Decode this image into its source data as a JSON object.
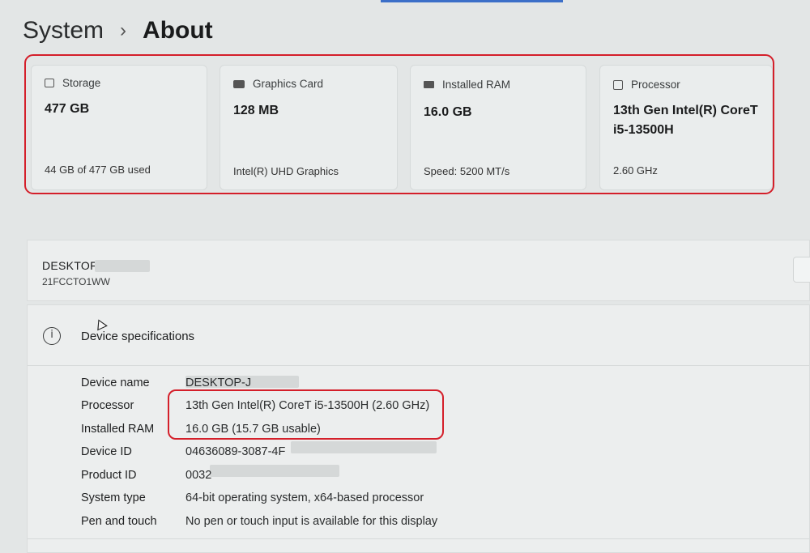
{
  "header": {
    "parent": "System",
    "separator": "›",
    "current": "About"
  },
  "cards": [
    {
      "icon": "storage-icon",
      "label": "Storage",
      "value": "477 GB",
      "sub": "44 GB of 477 GB used"
    },
    {
      "icon": "graphics-card-icon",
      "label": "Graphics Card",
      "value": "128 MB",
      "sub": "Intel(R) UHD Graphics"
    },
    {
      "icon": "ram-icon",
      "label": "Installed RAM",
      "value": "16.0 GB",
      "sub": "Speed: 5200 MT/s"
    },
    {
      "icon": "processor-icon",
      "label": "Processor",
      "value": "13th Gen Intel(R) CoreT i5-13500H",
      "sub": "2.60 GHz"
    }
  ],
  "device": {
    "name": "DESKTOF",
    "model": "21FCCTO1WW"
  },
  "specs": {
    "title": "Device specifications",
    "rows": [
      {
        "label": "Device name",
        "value": "DESKTOP-J"
      },
      {
        "label": "Processor",
        "value": "13th Gen Intel(R) CoreT i5-13500H (2.60 GHz)"
      },
      {
        "label": "Installed RAM",
        "value": "16.0 GB (15.7 GB usable)"
      },
      {
        "label": "Device ID",
        "value": "04636089-3087-4F"
      },
      {
        "label": "Product ID",
        "value": "0032"
      },
      {
        "label": "System type",
        "value": "64-bit operating system, x64-based processor"
      },
      {
        "label": "Pen and touch",
        "value": "No pen or touch input is available for this display"
      }
    ]
  },
  "colors": {
    "highlight": "#d41f2a",
    "accent": "#3c6fc8",
    "background": "#e3e6e6"
  }
}
